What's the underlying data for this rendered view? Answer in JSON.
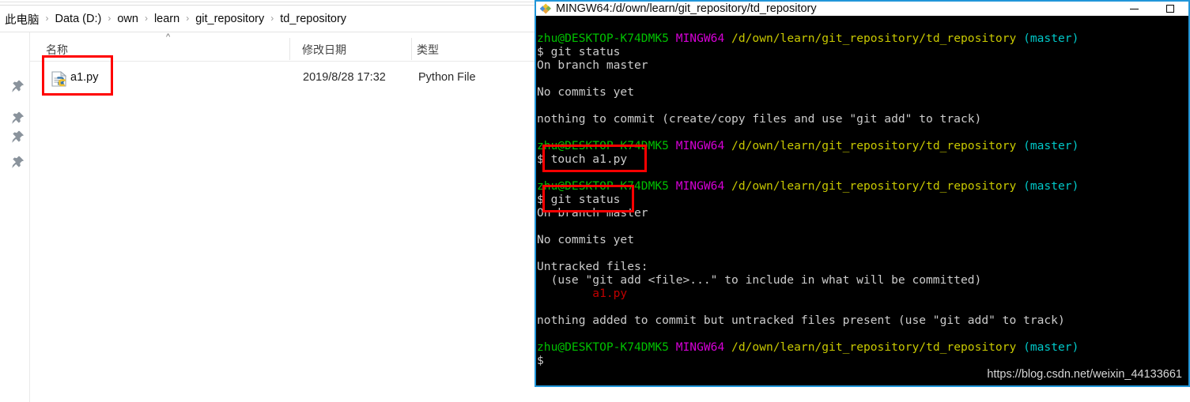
{
  "explorer": {
    "breadcrumb": {
      "name": "address-breadcrumb",
      "separator": "›",
      "items": [
        {
          "label": "此电脑"
        },
        {
          "label": "Data (D:)"
        },
        {
          "label": "own"
        },
        {
          "label": "learn"
        },
        {
          "label": "git_repository"
        },
        {
          "label": "td_repository"
        }
      ]
    },
    "nav_rail": {
      "pin_icon_name": "pushpin-icon",
      "pin_count": 4,
      "pin_tops": [
        100,
        140,
        164,
        196
      ]
    },
    "columns": [
      {
        "key": "name",
        "label": "名称"
      },
      {
        "key": "date",
        "label": "修改日期"
      },
      {
        "key": "type",
        "label": "类型"
      }
    ],
    "sort_indicator": "^",
    "rows": [
      {
        "icon": "python-file-icon",
        "name": "a1.py",
        "date": "2019/8/28 17:32",
        "type": "Python File"
      }
    ],
    "highlight_color": "#ff0000"
  },
  "terminal": {
    "title": "MINGW64:/d/own/learn/git_repository/td_repository",
    "icon_name": "git-bash-icon",
    "window_controls": [
      {
        "name": "minimize-button",
        "glyph": "—"
      },
      {
        "name": "maximize-button",
        "glyph": "□"
      }
    ],
    "border_color": "#2196d9",
    "prompt": {
      "user_host": "zhu@DESKTOP-K74DMK5",
      "shell": "MINGW64",
      "path": "/d/own/learn/git_repository/td_repository",
      "branch": "(master)",
      "symbol": "$"
    },
    "colors": {
      "user_host": "#00c000",
      "shell": "#d600d6",
      "path": "#c8c800",
      "branch": "#00c8c8",
      "untracked_file": "#c00000",
      "text": "#c8c8c8"
    },
    "lines": [
      {
        "type": "prompt"
      },
      {
        "type": "command",
        "text": "$ git status"
      },
      {
        "type": "text",
        "text": "On branch master"
      },
      {
        "type": "blank",
        "text": ""
      },
      {
        "type": "text",
        "text": "No commits yet"
      },
      {
        "type": "blank",
        "text": ""
      },
      {
        "type": "text",
        "text": "nothing to commit (create/copy files and use \"git add\" to track)"
      },
      {
        "type": "blank",
        "text": ""
      },
      {
        "type": "prompt"
      },
      {
        "type": "command",
        "text": "$ touch a1.py"
      },
      {
        "type": "blank",
        "text": ""
      },
      {
        "type": "prompt"
      },
      {
        "type": "command",
        "text": "$ git status"
      },
      {
        "type": "text",
        "text": "On branch master"
      },
      {
        "type": "blank",
        "text": ""
      },
      {
        "type": "text",
        "text": "No commits yet"
      },
      {
        "type": "blank",
        "text": ""
      },
      {
        "type": "text",
        "text": "Untracked files:"
      },
      {
        "type": "text",
        "text": "  (use \"git add <file>...\" to include in what will be committed)"
      },
      {
        "type": "untracked",
        "text": "        a1.py"
      },
      {
        "type": "blank",
        "text": ""
      },
      {
        "type": "text",
        "text": "nothing added to commit but untracked files present (use \"git add\" to track)"
      },
      {
        "type": "blank",
        "text": ""
      },
      {
        "type": "prompt"
      },
      {
        "type": "command",
        "text": "$"
      }
    ],
    "highlights": [
      {
        "name": "touch-command-highlight",
        "label": "touch a1.py"
      },
      {
        "name": "git-status-command-highlight",
        "label": "git status"
      }
    ]
  },
  "watermark": "https://blog.csdn.net/weixin_44133661"
}
